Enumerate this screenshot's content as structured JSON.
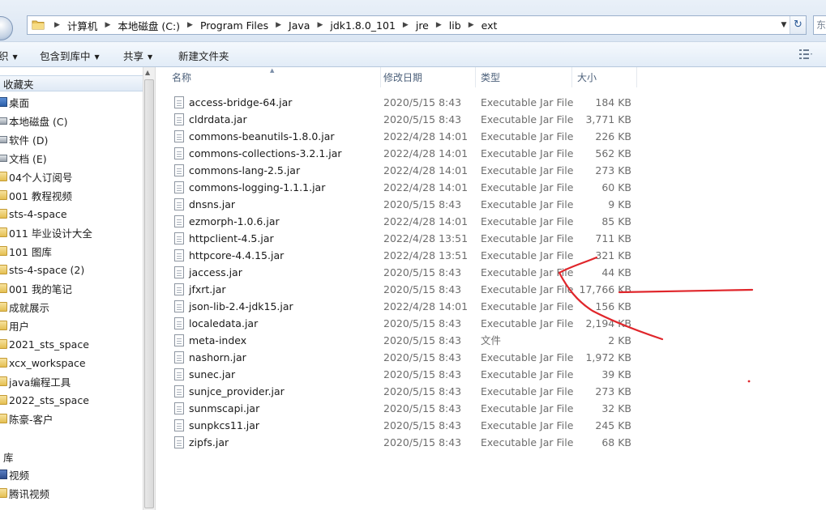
{
  "address_bar": {
    "segments": [
      "计算机",
      "本地磁盘 (C:)",
      "Program Files",
      "Java",
      "jdk1.8.0_101",
      "jre",
      "lib",
      "ext"
    ],
    "search_text": "东"
  },
  "toolbar": {
    "organize_partial": "织",
    "include_in_library": "包含到库中",
    "share": "共享",
    "new_folder": "新建文件夹"
  },
  "nav": {
    "favorites_header": "收藏夹",
    "items": [
      {
        "label": "桌面",
        "icon": "desktop-icon"
      },
      {
        "label": "本地磁盘 (C)",
        "icon": "drive-icon"
      },
      {
        "label": "软件 (D)",
        "icon": "drive-icon"
      },
      {
        "label": "文档 (E)",
        "icon": "drive-icon"
      },
      {
        "label": "04个人订阅号",
        "icon": "folder-icon"
      },
      {
        "label": "001 教程视频",
        "icon": "folder-icon"
      },
      {
        "label": "sts-4-space",
        "icon": "folder-icon"
      },
      {
        "label": "011 毕业设计大全",
        "icon": "folder-icon"
      },
      {
        "label": "101 图库",
        "icon": "folder-icon"
      },
      {
        "label": "sts-4-space (2)",
        "icon": "folder-icon"
      },
      {
        "label": "001 我的笔记",
        "icon": "folder-icon"
      },
      {
        "label": "成就展示",
        "icon": "folder-icon"
      },
      {
        "label": "用户",
        "icon": "folder-icon"
      },
      {
        "label": "2021_sts_space",
        "icon": "folder-icon"
      },
      {
        "label": "xcx_workspace",
        "icon": "folder-icon"
      },
      {
        "label": "java编程工具",
        "icon": "folder-icon"
      },
      {
        "label": "2022_sts_space",
        "icon": "folder-icon"
      },
      {
        "label": "陈豪-客户",
        "icon": "folder-icon"
      }
    ],
    "libraries_header": "库",
    "library_items": [
      {
        "label": "视频",
        "icon": "video-library-icon"
      },
      {
        "label": "腾讯视频",
        "icon": "folder-icon"
      }
    ]
  },
  "columns": {
    "name": "名称",
    "date": "修改日期",
    "type": "类型",
    "size": "大小"
  },
  "files": [
    {
      "name": "access-bridge-64.jar",
      "date": "2020/5/15 8:43",
      "type": "Executable Jar File",
      "size": "184 KB"
    },
    {
      "name": "cldrdata.jar",
      "date": "2020/5/15 8:43",
      "type": "Executable Jar File",
      "size": "3,771 KB"
    },
    {
      "name": "commons-beanutils-1.8.0.jar",
      "date": "2022/4/28 14:01",
      "type": "Executable Jar File",
      "size": "226 KB"
    },
    {
      "name": "commons-collections-3.2.1.jar",
      "date": "2022/4/28 14:01",
      "type": "Executable Jar File",
      "size": "562 KB"
    },
    {
      "name": "commons-lang-2.5.jar",
      "date": "2022/4/28 14:01",
      "type": "Executable Jar File",
      "size": "273 KB"
    },
    {
      "name": "commons-logging-1.1.1.jar",
      "date": "2022/4/28 14:01",
      "type": "Executable Jar File",
      "size": "60 KB"
    },
    {
      "name": "dnsns.jar",
      "date": "2020/5/15 8:43",
      "type": "Executable Jar File",
      "size": "9 KB"
    },
    {
      "name": "ezmorph-1.0.6.jar",
      "date": "2022/4/28 14:01",
      "type": "Executable Jar File",
      "size": "85 KB"
    },
    {
      "name": "httpclient-4.5.jar",
      "date": "2022/4/28 13:51",
      "type": "Executable Jar File",
      "size": "711 KB"
    },
    {
      "name": "httpcore-4.4.15.jar",
      "date": "2022/4/28 13:51",
      "type": "Executable Jar File",
      "size": "321 KB"
    },
    {
      "name": "jaccess.jar",
      "date": "2020/5/15 8:43",
      "type": "Executable Jar File",
      "size": "44 KB"
    },
    {
      "name": "jfxrt.jar",
      "date": "2020/5/15 8:43",
      "type": "Executable Jar File",
      "size": "17,766 KB"
    },
    {
      "name": "json-lib-2.4-jdk15.jar",
      "date": "2022/4/28 14:01",
      "type": "Executable Jar File",
      "size": "156 KB"
    },
    {
      "name": "localedata.jar",
      "date": "2020/5/15 8:43",
      "type": "Executable Jar File",
      "size": "2,194 KB"
    },
    {
      "name": "meta-index",
      "date": "2020/5/15 8:43",
      "type": "文件",
      "size": "2 KB"
    },
    {
      "name": "nashorn.jar",
      "date": "2020/5/15 8:43",
      "type": "Executable Jar File",
      "size": "1,972 KB"
    },
    {
      "name": "sunec.jar",
      "date": "2020/5/15 8:43",
      "type": "Executable Jar File",
      "size": "39 KB"
    },
    {
      "name": "sunjce_provider.jar",
      "date": "2020/5/15 8:43",
      "type": "Executable Jar File",
      "size": "273 KB"
    },
    {
      "name": "sunmscapi.jar",
      "date": "2020/5/15 8:43",
      "type": "Executable Jar File",
      "size": "32 KB"
    },
    {
      "name": "sunpkcs11.jar",
      "date": "2020/5/15 8:43",
      "type": "Executable Jar File",
      "size": "245 KB"
    },
    {
      "name": "zipfs.jar",
      "date": "2020/5/15 8:43",
      "type": "Executable Jar File",
      "size": "68 KB"
    }
  ],
  "annotation": {
    "color": "#e0262b",
    "points_to": "jfxrt.jar"
  }
}
